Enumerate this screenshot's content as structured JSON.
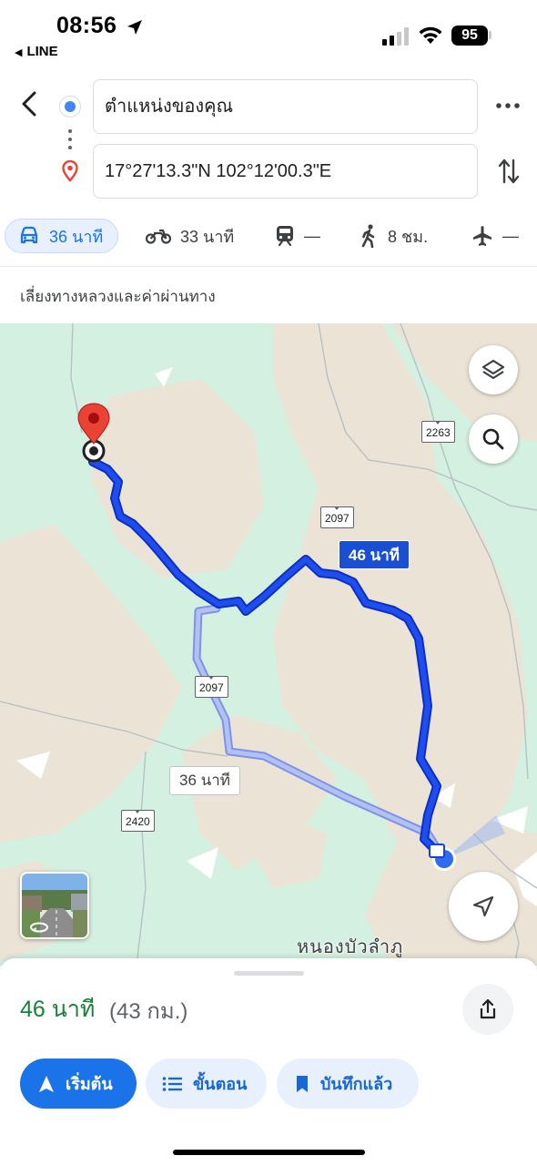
{
  "status_bar": {
    "time": "08:56",
    "back_app": "LINE",
    "battery": "95"
  },
  "directions": {
    "origin": "ตำแหน่งของคุณ",
    "destination": "17°27'13.3\"N 102°12'00.3\"E"
  },
  "modes": [
    {
      "name": "drive",
      "icon": "car-icon",
      "value": "36 นาที",
      "active": true
    },
    {
      "name": "motorcycle",
      "icon": "motorcycle-icon",
      "value": "33 นาที",
      "active": false
    },
    {
      "name": "transit",
      "icon": "train-icon",
      "value": "—",
      "active": false
    },
    {
      "name": "walk",
      "icon": "walk-icon",
      "value": "8 ชม.",
      "active": false
    },
    {
      "name": "flight",
      "icon": "plane-icon",
      "value": "—",
      "active": false
    }
  ],
  "route_options": "เลี่ยงทางหลวงและค่าผ่านทาง",
  "map": {
    "primary_route_time": "46 นาที",
    "alt_route_time": "36 นาที",
    "road_shields": [
      "2263",
      "2097",
      "2097",
      "2420"
    ],
    "place_label": "หนองบัวลำภู",
    "colors": {
      "primary_route": "#1a3fe0",
      "alt_route": "#a9b8f0",
      "land": "#d4f0e0",
      "terrain": "#e9e2d6",
      "water": "#ffffff"
    }
  },
  "summary": {
    "duration": "46 นาที",
    "distance": "(43 กม.)"
  },
  "actions": {
    "start": "เริ่มต้น",
    "steps": "ขั้นตอน",
    "saved": "บันทึกแล้ว"
  }
}
